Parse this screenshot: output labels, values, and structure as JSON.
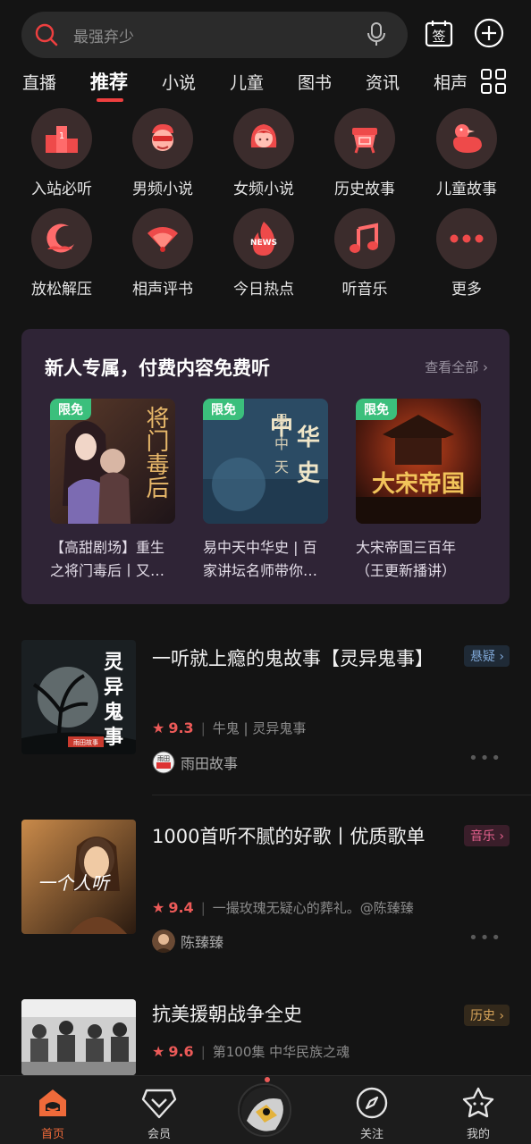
{
  "search": {
    "placeholder": "最强弃少"
  },
  "top_icons": {
    "sign": "sign-in-icon",
    "add": "plus-circle-icon"
  },
  "tabs": [
    "直播",
    "推荐",
    "小说",
    "儿童",
    "图书",
    "资讯",
    "相声"
  ],
  "active_tab": "推荐",
  "categories": [
    {
      "label": "入站必听",
      "icon": "must-listen-icon"
    },
    {
      "label": "男频小说",
      "icon": "male-novel-icon"
    },
    {
      "label": "女频小说",
      "icon": "female-novel-icon"
    },
    {
      "label": "历史故事",
      "icon": "history-icon"
    },
    {
      "label": "儿童故事",
      "icon": "duck-icon"
    },
    {
      "label": "放松解压",
      "icon": "moon-icon"
    },
    {
      "label": "相声评书",
      "icon": "fan-icon"
    },
    {
      "label": "今日热点",
      "icon": "news-fire-icon"
    },
    {
      "label": "听音乐",
      "icon": "music-note-icon"
    },
    {
      "label": "更多",
      "icon": "more-icon"
    }
  ],
  "promo": {
    "title": "新人专属，付费内容免费听",
    "more": "查看全部",
    "items": [
      {
        "badge": "限免",
        "title": "【高甜剧场】重生之将门毒后丨又…",
        "cover_text": "将门毒后"
      },
      {
        "badge": "限免",
        "title": "易中天中华史 | 百家讲坛名师带你…",
        "cover_text_a": "易中天",
        "cover_text_b": "中华史"
      },
      {
        "badge": "限免",
        "title": "大宋帝国三百年（王更新播讲）",
        "cover_text": "大宋帝国"
      }
    ]
  },
  "albums": [
    {
      "title": "一听就上瘾的鬼故事【灵异鬼事】",
      "tag": "悬疑",
      "tag_color": "#7fa7d6",
      "tag_bg": "#1f2a36",
      "score": "9.3",
      "meta": "牛鬼 | 灵异鬼事",
      "author": "雨田故事",
      "author_avatar_text": "雨田",
      "cover_text": "灵异鬼事",
      "cover_badge": "雨田故事"
    },
    {
      "title": "1000首听不腻的好歌丨优质歌单",
      "tag": "音乐",
      "tag_color": "#e3608c",
      "tag_bg": "#3a1e2a",
      "score": "9.4",
      "meta": "一撮玫瑰无疑心的葬礼。@陈臻臻",
      "author": "陈臻臻",
      "cover_text": "一个人听"
    },
    {
      "title": "抗美援朝战争全史",
      "tag": "历史",
      "tag_color": "#d7a45a",
      "tag_bg": "#33291b",
      "score": "9.6",
      "meta": "第100集 中华民族之魂"
    }
  ],
  "bottom_nav": [
    {
      "label": "首页",
      "icon": "home-icon",
      "active": true
    },
    {
      "label": "会员",
      "icon": "vip-diamond-icon",
      "active": false
    },
    {
      "label": "关注",
      "icon": "compass-icon",
      "active": false
    },
    {
      "label": "我的",
      "icon": "profile-star-icon",
      "active": false
    }
  ],
  "colors": {
    "accent": "#ee3f3f",
    "active_nav": "#ef6a3a",
    "promo_bg": "#2f2436",
    "badge_green": "#3bbf7c"
  }
}
